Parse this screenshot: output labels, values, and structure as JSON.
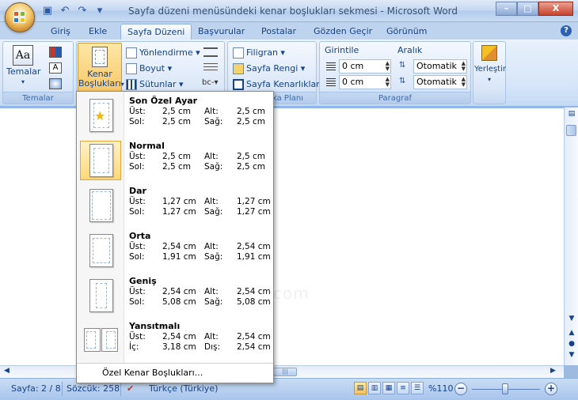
{
  "window": {
    "title": "Sayfa düzeni menüsündeki  kenar boşlukları sekmesi - Microsoft Word",
    "controls": [
      "–",
      "□",
      "X"
    ]
  },
  "tabs": [
    "Giriş",
    "Ekle",
    "Sayfa Düzeni",
    "Başvurular",
    "Postalar",
    "Gözden Geçir",
    "Görünüm"
  ],
  "active_tab": "Sayfa Düzeni",
  "ribbon": {
    "temalar": {
      "label": "Temalar",
      "group": "Temalar"
    },
    "kenar": {
      "line1": "Kenar",
      "line2": "Boşlukları"
    },
    "yonlendirme": "Yönlendirme",
    "boyut": "Boyut",
    "sutunlar": "Sütunlar",
    "filigran": "Filigran",
    "sayfa_rengi": "Sayfa Rengi",
    "sayfa_kenarliklari": "Sayfa Kenarlıkları",
    "sayfa_plani_group": "ka Planı",
    "girinti": "Girintile",
    "aralik": "Aralık",
    "girinti_left": "0 cm",
    "girinti_right": "0 cm",
    "aralik_before": "Otomatik",
    "aralik_after": "Otomatik",
    "paragraf_group": "Paragraf",
    "yerlestir": "Yerleştir"
  },
  "margins_menu": {
    "items": [
      {
        "name": "Son Özel Ayar",
        "k1": "Üst:",
        "v1": "2,5 cm",
        "k2": "Alt:",
        "v2": "2,5 cm",
        "k3": "Sol:",
        "v3": "2,5 cm",
        "k4": "Sağ:",
        "v4": "2,5 cm"
      },
      {
        "name": "Normal",
        "k1": "Üst:",
        "v1": "2,5 cm",
        "k2": "Alt:",
        "v2": "2,5 cm",
        "k3": "Sol:",
        "v3": "2,5 cm",
        "k4": "Sağ:",
        "v4": "2,5 cm"
      },
      {
        "name": "Dar",
        "k1": "Üst:",
        "v1": "1,27 cm",
        "k2": "Alt:",
        "v2": "1,27 cm",
        "k3": "Sol:",
        "v3": "1,27 cm",
        "k4": "Sağ:",
        "v4": "1,27 cm"
      },
      {
        "name": "Orta",
        "k1": "Üst:",
        "v1": "2,54 cm",
        "k2": "Alt:",
        "v2": "2,54 cm",
        "k3": "Sol:",
        "v3": "1,91 cm",
        "k4": "Sağ:",
        "v4": "1,91 cm"
      },
      {
        "name": "Geniş",
        "k1": "Üst:",
        "v1": "2,54 cm",
        "k2": "Alt:",
        "v2": "2,54 cm",
        "k3": "Sol:",
        "v3": "5,08 cm",
        "k4": "Sağ:",
        "v4": "5,08 cm"
      },
      {
        "name": "Yansıtmalı",
        "k1": "Üst:",
        "v1": "2,54 cm",
        "k2": "Alt:",
        "v2": "2,54 cm",
        "k3": "İç:",
        "v3": "3,18 cm",
        "k4": "Dış:",
        "v4": "2,54 cm"
      }
    ],
    "custom": "Özel Kenar Boşlukları..."
  },
  "status": {
    "page": "Sayfa: 2 / 8",
    "words": "Sözcük: 258",
    "language": "Türkçe (Türkiye)",
    "zoom": "%110"
  },
  "watermark": "ders.com",
  "colors": {
    "accent": "#15428b",
    "selected": "#ffd77a"
  }
}
